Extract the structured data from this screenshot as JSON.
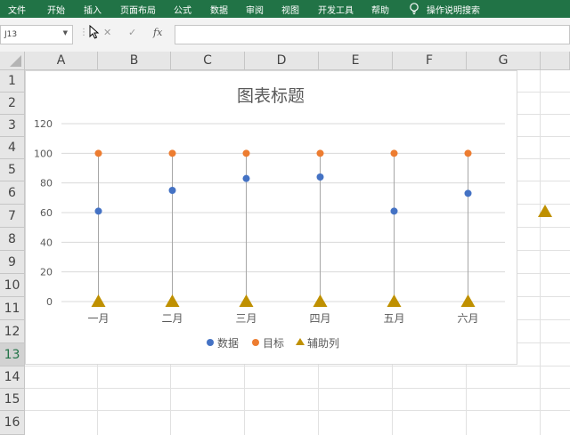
{
  "ribbon": {
    "tabs": [
      "文件",
      "开始",
      "插入",
      "页面布局",
      "公式",
      "数据",
      "审阅",
      "视图",
      "开发工具",
      "帮助"
    ],
    "tell_me": "操作说明搜索"
  },
  "formula_bar": {
    "name_box": "J13",
    "cancel_glyph": "✕",
    "enter_glyph": "✓",
    "fx_label": "fx",
    "value": ""
  },
  "sheet": {
    "columns": [
      "A",
      "B",
      "C",
      "D",
      "E",
      "F",
      "G"
    ],
    "rows": [
      "1",
      "2",
      "3",
      "4",
      "5",
      "6",
      "7",
      "8",
      "9",
      "10",
      "11",
      "12",
      "13",
      "14",
      "15",
      "16"
    ],
    "selected_row": "13"
  },
  "colors": {
    "ribbon": "#217346",
    "series_data": "#4472C4",
    "series_target": "#ED7D31",
    "series_helper": "#BF9000",
    "drop_line": "#a6a6a6",
    "gridline": "#d9d9d9"
  },
  "chart_data": {
    "type": "scatter",
    "title": "图表标题",
    "categories": [
      "一月",
      "二月",
      "三月",
      "四月",
      "五月",
      "六月"
    ],
    "ylim": [
      0,
      120
    ],
    "yticks": [
      0,
      20,
      40,
      60,
      80,
      100,
      120
    ],
    "grid": true,
    "legend_position": "bottom",
    "drop_lines": true,
    "series": [
      {
        "name": "数据",
        "marker": "circle",
        "values": [
          61,
          75,
          83,
          84,
          61,
          73
        ]
      },
      {
        "name": "目标",
        "marker": "circle",
        "values": [
          100,
          100,
          100,
          100,
          100,
          100
        ]
      },
      {
        "name": "辅助列",
        "marker": "triangle",
        "values": [
          0,
          0,
          0,
          0,
          0,
          0
        ]
      }
    ]
  }
}
